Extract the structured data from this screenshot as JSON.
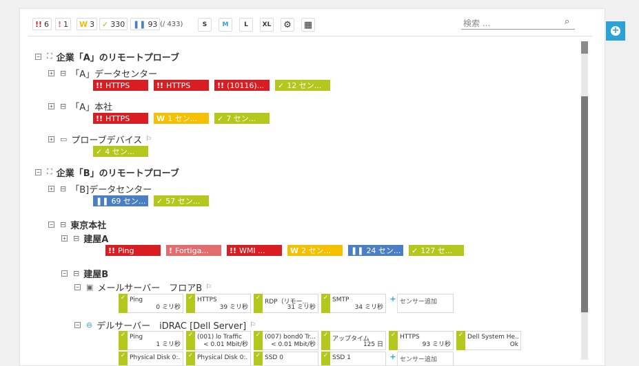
{
  "toolbar": {
    "stats": [
      {
        "name": "down",
        "icon": "!!",
        "count": "6",
        "color": "red"
      },
      {
        "name": "down-partial",
        "icon": "!",
        "count": "1",
        "color": "pink"
      },
      {
        "name": "warning",
        "icon": "W",
        "count": "3",
        "color": "yellow"
      },
      {
        "name": "up",
        "icon": "✓",
        "count": "330",
        "color": "green"
      },
      {
        "name": "paused",
        "icon": "❚❚",
        "count": "93",
        "color": "blue"
      }
    ],
    "total": "(/ 433)",
    "sizes": [
      "S",
      "M",
      "L",
      "XL"
    ],
    "active_size": "M",
    "search_placeholder": "検索 ..."
  },
  "tree": {
    "group_a": {
      "name": "企業「A」のリモートプローブ",
      "dc": {
        "name": "「A」データセンター",
        "tiles": [
          {
            "icon": "!!",
            "label": "HTTPS",
            "color": "red"
          },
          {
            "icon": "!!",
            "label": "HTTPS",
            "color": "red"
          },
          {
            "icon": "!!",
            "label": "(10116)...",
            "color": "red"
          },
          {
            "icon": "✓",
            "label": "12 セン...",
            "color": "green"
          }
        ]
      },
      "hq": {
        "name": "「A」本社",
        "tiles": [
          {
            "icon": "!!",
            "label": "HTTPS",
            "color": "red"
          },
          {
            "icon": "W",
            "label": "1 セン...",
            "color": "yellow"
          },
          {
            "icon": "✓",
            "label": "7 セン...",
            "color": "green"
          }
        ]
      },
      "probe": {
        "name": "プローブデバイス",
        "tiles": [
          {
            "icon": "✓",
            "label": "4 セン...",
            "color": "green"
          }
        ]
      }
    },
    "group_b": {
      "name": "企業「B」のリモートプローブ",
      "dc": {
        "name": "「B]データセンター",
        "tiles": [
          {
            "icon": "❚❚",
            "label": "69 セン...",
            "color": "blue"
          },
          {
            "icon": "✓",
            "label": "57 セン...",
            "color": "green"
          }
        ]
      },
      "tokyo": {
        "name": "東京本社",
        "bldg_a": {
          "name": "建屋A",
          "tiles": [
            {
              "icon": "!!",
              "label": "Ping",
              "color": "red"
            },
            {
              "icon": "!",
              "label": "Fortiga...",
              "color": "pink"
            },
            {
              "icon": "!!",
              "label": "WMI ...",
              "color": "red"
            },
            {
              "icon": "W",
              "label": "2 セン...",
              "color": "yellow"
            },
            {
              "icon": "❚❚",
              "label": "24 セン...",
              "color": "blue"
            },
            {
              "icon": "✓",
              "label": "127 セ...",
              "color": "green"
            }
          ]
        },
        "bldg_b": {
          "name": "建屋B",
          "mail": {
            "name": "メールサーバー　フロアB",
            "sensors": [
              {
                "name": "Ping",
                "value": "0 ミリ秒"
              },
              {
                "name": "HTTPS",
                "value": "39 ミリ秒"
              },
              {
                "name": "RDP（リモー...",
                "value": "31 ミリ秒"
              },
              {
                "name": "SMTP",
                "value": "34 ミリ秒"
              }
            ],
            "add_label": "センサー追加"
          },
          "dell": {
            "name": "デルサーバー　iDRAC [Dell Server]",
            "sensors": [
              {
                "name": "Ping",
                "value": "1 ミリ秒"
              },
              {
                "name": "(001) lo Traffic",
                "value": "< 0.01 Mbit/秒"
              },
              {
                "name": "(007) bond0 Tr...",
                "value": "< 0.01 Mbit/秒"
              },
              {
                "name": "アップタイム",
                "value": "125 日"
              },
              {
                "name": "HTTPS",
                "value": "93 ミリ秒"
              },
              {
                "name": "Dell System He...",
                "value": "Ok"
              }
            ],
            "sensors2": [
              {
                "name": "Physical Disk 0:...",
                "value": ""
              },
              {
                "name": "Physical Disk 0:...",
                "value": ""
              },
              {
                "name": "SSD 0",
                "value": ""
              },
              {
                "name": "SSD 1",
                "value": ""
              }
            ],
            "add_label": "センサー追加"
          }
        }
      }
    }
  }
}
